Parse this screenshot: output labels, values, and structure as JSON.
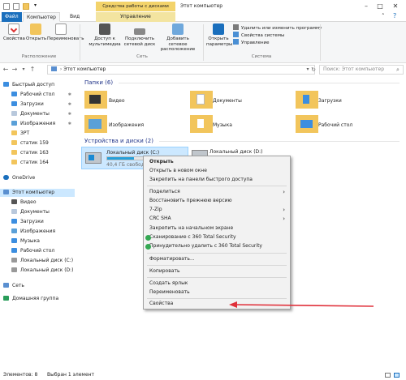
{
  "titlebar": {
    "context_tab": "Средства работы с дисками",
    "window_title": "Этот компьютер"
  },
  "ribbon_tabs": {
    "file": "Файл",
    "computer": "Компьютер",
    "view": "Вид",
    "manage": "Управление"
  },
  "ribbon": {
    "btn_properties": "Свойства",
    "btn_open": "Открыть",
    "btn_rename": "Переименовать",
    "grp_location": "Расположение",
    "btn_media": "Доступ к мультимедиа",
    "btn_map_drive": "Подключить сетевой диск",
    "btn_add_net": "Добавить сетевое расположение",
    "grp_network": "Сеть",
    "btn_open_params": "Открыть параметры",
    "sys_uninstall": "Удалить или изменить программу",
    "sys_properties": "Свойства системы",
    "sys_manage": "Управление",
    "grp_system": "Система"
  },
  "address": {
    "path": "Этот компьютер",
    "search_placeholder": "Поиск: Этот компьютер"
  },
  "nav": {
    "quick_access": "Быстрый доступ",
    "items_quick": [
      "Рабочий стол",
      "Загрузки",
      "Документы",
      "Изображения",
      "ЗРТ",
      "статик 159",
      "статик 163",
      "статик 164"
    ],
    "onedrive": "OneDrive",
    "this_pc": "Этот компьютер",
    "items_pc": [
      "Видео",
      "Документы",
      "Загрузки",
      "Изображения",
      "Музыка",
      "Рабочий стол",
      "Локальный диск (C:)",
      "Локальный диск (D:)"
    ],
    "network": "Сеть",
    "homegroup": "Домашняя группа"
  },
  "content": {
    "folders_header": "Папки (6)",
    "folders": [
      "Видео",
      "Документы",
      "Загрузки",
      "Изображения",
      "Музыка",
      "Рабочий стол"
    ],
    "devices_header": "Устройства и диски (2)",
    "drive_c_name": "Локальный диск (C:)",
    "drive_c_free": "40,4 ГБ свободно",
    "drive_d_name": "Локальный диск (D:)",
    "drive_c_usage": 0.35
  },
  "context_menu": {
    "open": "Открыть",
    "open_new_window": "Открыть в новом окне",
    "pin_quick": "Закрепить на панели быстрого доступа",
    "share": "Поделиться",
    "restore": "Восстановить прежнюю версию",
    "zip": "7-Zip",
    "crc": "CRC SHA",
    "pin_start": "Закрепить на начальном экране",
    "scan360": "Сканирование с 360 Total Security",
    "force_delete": "Принудительно удалить с  360 Total Security",
    "format": "Форматировать...",
    "copy": "Копировать",
    "shortcut": "Создать ярлык",
    "rename": "Переименовать",
    "properties": "Свойства"
  },
  "status": {
    "items": "Элементов: 8",
    "selected": "Выбран 1 элемент"
  },
  "colors": {
    "accent": "#1a6fbd",
    "context_tab": "#f3d36b",
    "folder": "#f2c55c",
    "selection": "#cce8ff",
    "arrow": "#e0303a"
  }
}
